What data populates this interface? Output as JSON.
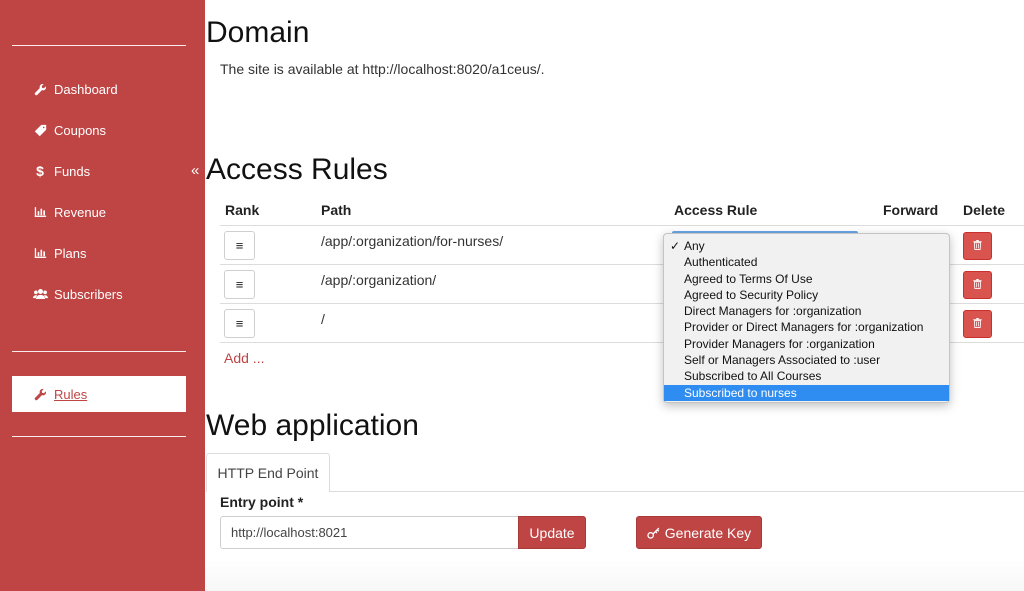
{
  "sidebar": {
    "items": [
      {
        "label": "Dashboard",
        "icon": "wrench-icon"
      },
      {
        "label": "Coupons",
        "icon": "ticket-icon"
      },
      {
        "label": "Funds",
        "icon": "dollar-icon"
      },
      {
        "label": "Revenue",
        "icon": "bar-chart-icon"
      },
      {
        "label": "Plans",
        "icon": "bar-chart-icon"
      },
      {
        "label": "Subscribers",
        "icon": "users-icon"
      }
    ],
    "active_item": {
      "label": "Rules",
      "icon": "wrench-icon"
    },
    "collapse_glyph": "«"
  },
  "domain": {
    "title": "Domain",
    "text": "The site is available at http://localhost:8020/a1ceus/."
  },
  "access_rules": {
    "title": "Access Rules",
    "headers": {
      "rank": "Rank",
      "path": "Path",
      "access_rule": "Access Rule",
      "forward": "Forward",
      "delete": "Delete"
    },
    "rows": [
      {
        "path": "/app/:organization/for-nurses/"
      },
      {
        "path": "/app/:organization/"
      },
      {
        "path": "/"
      }
    ],
    "rank_glyph": "≡",
    "add_label": "Add ...",
    "dropdown": {
      "options": [
        "Any",
        "Authenticated",
        "Agreed to Terms Of Use",
        "Agreed to Security Policy",
        "Direct Managers for :organization",
        "Provider or Direct Managers for :organization",
        "Provider Managers for :organization",
        "Self or Managers Associated to :user",
        "Subscribed to All Courses",
        "Subscribed to nurses"
      ],
      "checked": "Any",
      "highlighted": "Subscribed to nurses",
      "check_glyph": "✓"
    }
  },
  "web_application": {
    "title": "Web application",
    "tab_label": "HTTP End Point",
    "entry_label": "Entry point *",
    "entry_value": "http://localhost:8021",
    "update_label": "Update",
    "generate_key_label": "Generate Key"
  },
  "colors": {
    "brand": "#bf4444",
    "danger": "#d9534f",
    "highlight": "#2f8cf0"
  }
}
